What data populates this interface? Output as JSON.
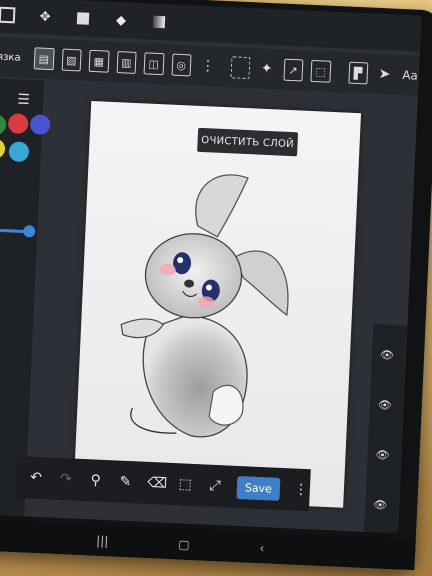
{
  "toolbar": {
    "left_label": "вязка",
    "text_tool": "Aa"
  },
  "canvas": {
    "clear_layer_label": "ОЧИСТИТЬ СЛОЙ"
  },
  "bottom_toolbar": {
    "save_label": "Save"
  },
  "palette": {
    "colors": [
      "#2e8a3a",
      "#d83c3c",
      "#4b52d3",
      "#e2d23a",
      "#38a7d6"
    ]
  }
}
